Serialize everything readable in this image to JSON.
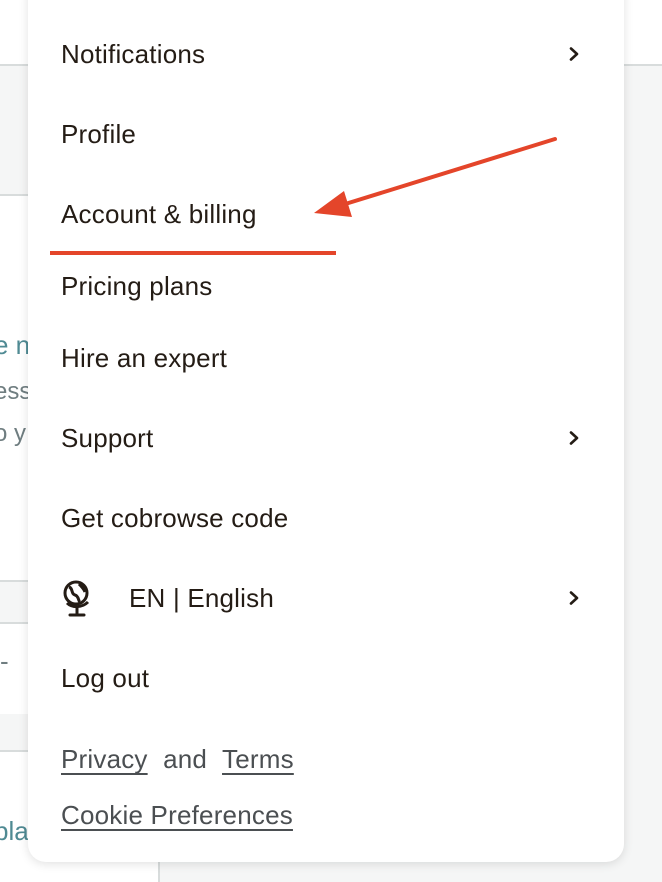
{
  "background": {
    "frag_1": "e n",
    "frag_2": "ess",
    "frag_3": "o y",
    "frag_4": "-",
    "frag_5": "pla"
  },
  "menu": {
    "items": [
      {
        "label": "Notifications",
        "has_submenu": true
      },
      {
        "label": "Profile",
        "has_submenu": false
      },
      {
        "label": "Account & billing",
        "has_submenu": false
      },
      {
        "label": "Pricing plans",
        "has_submenu": false
      },
      {
        "label": "Hire an expert",
        "has_submenu": false
      },
      {
        "label": "Support",
        "has_submenu": true
      },
      {
        "label": "Get cobrowse code",
        "has_submenu": false
      },
      {
        "label": "EN | English",
        "has_submenu": true,
        "icon": "globe-icon"
      },
      {
        "label": "Log out",
        "has_submenu": false
      }
    ],
    "footer": {
      "privacy": "Privacy",
      "and": "and",
      "terms": "Terms",
      "cookie": "Cookie Preferences"
    }
  },
  "annotation": {
    "color": "#e4452a",
    "target": "Account & billing"
  }
}
